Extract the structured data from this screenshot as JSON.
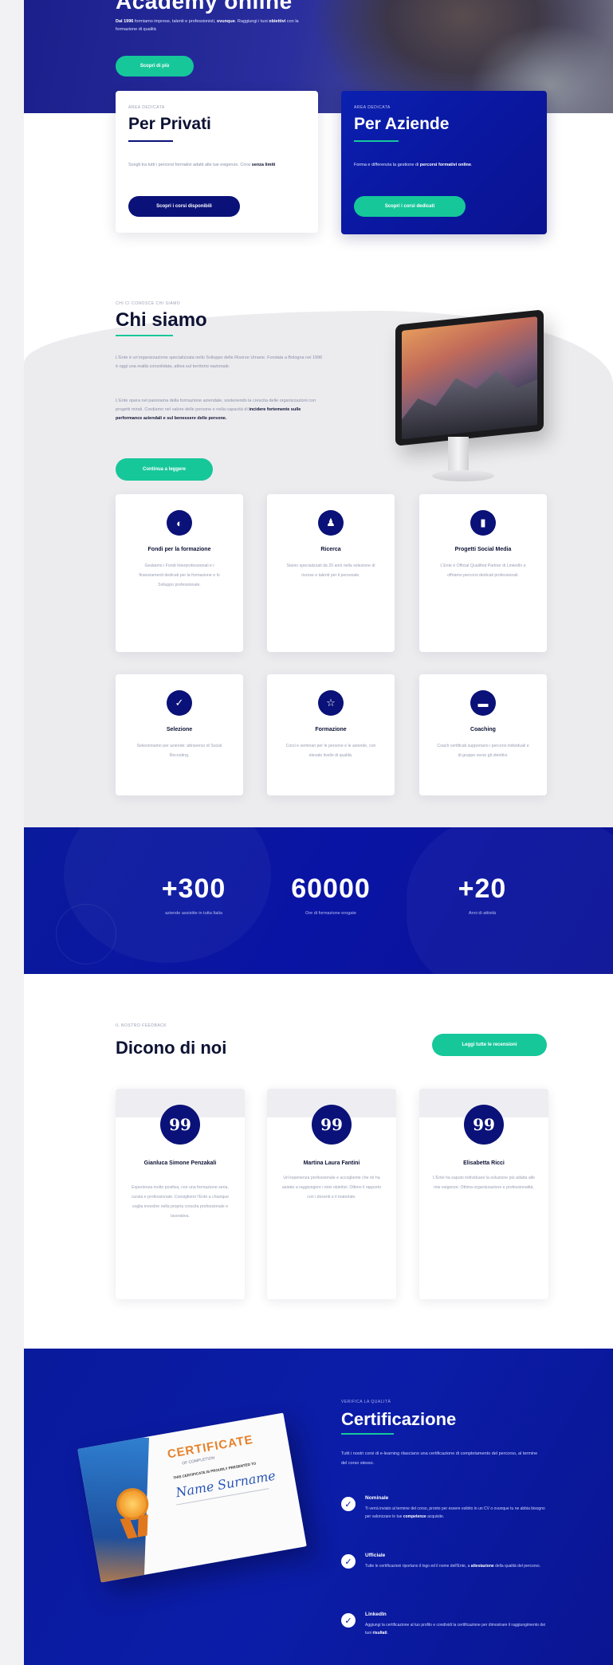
{
  "hero": {
    "title": "Academy online",
    "subtitle_prefix": "Dal 1996",
    "subtitle_mid": " formiamo imprese, talenti e professionisti, ",
    "subtitle_bold": "ovunque",
    "subtitle_line2_a": ". Raggiungi i tuoi ",
    "subtitle_line2_b": "obiettivi",
    "subtitle_line2_c": " con la formazione di qualità",
    "cta": "Scopri di più"
  },
  "privati": {
    "eyebrow": "AREA DEDICATA",
    "title": "Per Privati",
    "text_a": "Scegli tra tutti i percorsi formativi adatti alle tue esigenze. ",
    "text_b": "Corsi ",
    "text_bold": "senza limiti",
    "button": "Scopri i corsi disponibili"
  },
  "aziende": {
    "eyebrow": "AREA DEDICATA",
    "title": "Per Aziende",
    "text_a": "Forma e differenzia la gestione di ",
    "text_bold": "percorsi formativi online",
    "text_c": ".",
    "button": "Scopri i corsi dedicati"
  },
  "chi_siamo": {
    "eyebrow": "CHI CI CONOSCE CHI SIAMO",
    "title": "Chi siamo",
    "p1": "L'Ente è un'organizzazione specializzata nello Sviluppo delle Risorse Umane. Fondata a Bologna nel 1996 è oggi una realtà consolidata, attiva sul territorio nazionale.",
    "p2_a": "L'Ente opera nel panorama della formazione aziendale, ",
    "p2_b": "sostenendo la crescita delle organizzazioni con progetti mirati. Crediamo nel valore delle persone e nella capacità di ",
    "p2_bold": "incidere fortemente sulle performance aziendali e sul benessere delle persone.",
    "button": "Continua a leggere"
  },
  "features": [
    {
      "icon": "◐",
      "title": "Fondi per la formazione",
      "text": "Gestiamo i Fondi Interprofessionali e i finanziamenti dedicati per la formazione e lo Sviluppo professionale."
    },
    {
      "icon": "♟",
      "title": "Ricerca",
      "text": "Siamo specializzati da 20 anni nella selezione di risorse e talenti per il personale."
    },
    {
      "icon": "▮",
      "title": "Progetti Social Media",
      "text": "L'Ente è Official Qualified Partner di LinkedIn e offriamo percorsi dedicati professionali."
    },
    {
      "icon": "✓",
      "title": "Selezione",
      "text": "Selezioniamo per aziende: attraverso di Social Recruiting."
    },
    {
      "icon": "☆",
      "title": "Formazione",
      "text": "Corsi e seminari per le persone e le aziende, con elevato livello di qualità."
    },
    {
      "icon": "▬",
      "title": "Coaching",
      "text": "Coach certificati supportano i percorsi individuali e di gruppo verso gli obiettivi."
    }
  ],
  "stats": [
    {
      "num": "+300",
      "label": "aziende assistite in tutta Italia"
    },
    {
      "num": "60000",
      "label": "Ore di formazione erogate"
    },
    {
      "num": "+20",
      "label": "Anni di attività"
    }
  ],
  "dicono": {
    "eyebrow": "IL NOSTRO FEEDBACK",
    "title": "Dicono di noi",
    "button": "Leggi tutte le recensioni",
    "quote_glyph": "99",
    "items": [
      {
        "name": "Gianluca Simone Penzakali",
        "text": "Esperienza molto positiva, con una formazione seria, curata e professionale. Consiglierei l'Ente a chiunque voglia investire nella propria crescita professionale e lavorativa."
      },
      {
        "name": "Martina Laura Fantini",
        "text": "Un'esperienza professionale e accogliente che mi ha aiutato a raggiungere i miei obiettivi. Ottimo il rapporto con i docenti e il materiale."
      },
      {
        "name": "Elisabetta Ricci",
        "text": "L'Ente ha saputo individuare la soluzione più adatta alle mie esigenze. Ottima organizzazione e professionalità."
      }
    ]
  },
  "cert": {
    "eyebrow": "VERIFICA LA QUALITÀ",
    "title": "Certificazione",
    "p": "Tutti i nostri corsi di e-learning rilasciano una certificazione di completamento del percorso, al termine del corso stesso.",
    "image": {
      "heading": "CERTIFICATE",
      "sub": "OF COMPLETION",
      "line": "THIS CERTIFICATE IS PROUDLY PRESENTED TO",
      "name": "Name Surname",
      "seal": "AWARD"
    },
    "items": [
      {
        "title": "Nominale",
        "text_a": "Ti verrà inviato al termine del corso, pronto per essere esibito in un CV o ovunque tu ne abbia bisogno per valorizzare le tue ",
        "text_bold": "competenze",
        "text_c": " acquisite."
      },
      {
        "title": "Ufficiale",
        "text_a": "Tutte le certificazioni riportano il logo ed il nome dell'Ente, a ",
        "text_bold": "attestazione",
        "text_c": " della qualità del percorso."
      },
      {
        "title": "LinkedIn",
        "text_a": "Aggiungi la certificazione al tuo profilo e condividi la certificazione per dimostrare il raggiungimento dei tuoi ",
        "text_bold": "risultati",
        "text_c": "."
      }
    ]
  }
}
